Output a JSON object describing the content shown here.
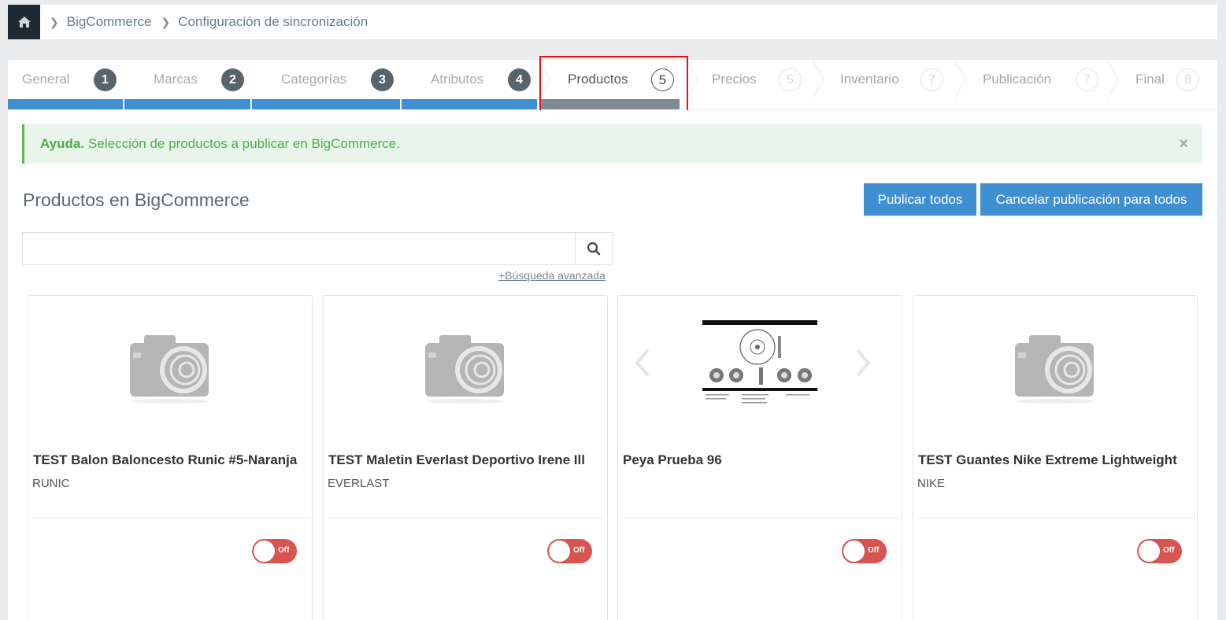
{
  "breadcrumb": {
    "items": [
      "BigCommerce",
      "Configuración de sincronización"
    ]
  },
  "steps": [
    {
      "label": "General",
      "num": "1",
      "state": "done"
    },
    {
      "label": "Marcas",
      "num": "2",
      "state": "done"
    },
    {
      "label": "Categorías",
      "num": "3",
      "state": "done"
    },
    {
      "label": "Atributos",
      "num": "4",
      "state": "done"
    },
    {
      "label": "Productos",
      "num": "5",
      "state": "current"
    },
    {
      "label": "Precios",
      "num": "5",
      "state": "todo"
    },
    {
      "label": "Inventario",
      "num": "7",
      "state": "todo"
    },
    {
      "label": "Publicación",
      "num": "7",
      "state": "todo"
    },
    {
      "label": "Final",
      "num": "8",
      "state": "todo"
    }
  ],
  "alert": {
    "strong": "Ayuda.",
    "text": "Selección de productos a publicar en BigCommerce.",
    "close": "×"
  },
  "main": {
    "title": "Productos en BigCommerce",
    "publish_all": "Publicar todos",
    "cancel_all": "Cancelar publicación para todos",
    "search_placeholder": "",
    "advanced_search": "+Búsqueda avanzada"
  },
  "products": [
    {
      "title": "TEST Balon Baloncesto Runic #5-Naranja",
      "brand": "RUNIC",
      "toggle": "Off",
      "image": "placeholder"
    },
    {
      "title": "TEST Maletin Everlast Deportivo Irene Ill",
      "brand": "EVERLAST",
      "toggle": "Off",
      "image": "placeholder"
    },
    {
      "title": "Peya Prueba 96",
      "brand": "",
      "toggle": "Off",
      "image": "brake-disc"
    },
    {
      "title": "TEST Guantes Nike Extreme Lightweight",
      "brand": "NIKE",
      "toggle": "Off",
      "image": "placeholder"
    }
  ],
  "colors": {
    "done": "#58646d",
    "bar_done": "#3f8fd2",
    "bar_current": "#7f8a92",
    "accent": "#3f8fd2",
    "toggle_off": "#d9534f",
    "highlight": "#e0131b"
  },
  "icons": {
    "home": "home-icon",
    "search": "search-icon",
    "camera": "camera-placeholder-icon"
  }
}
